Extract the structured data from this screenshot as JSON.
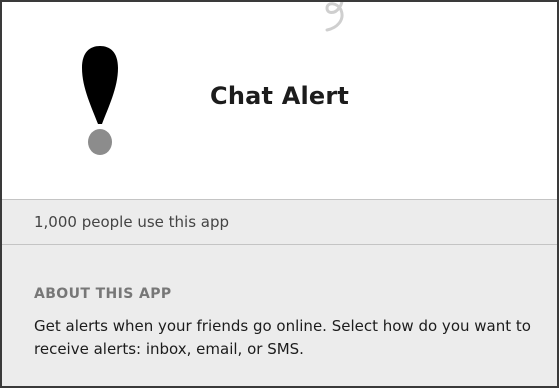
{
  "app": {
    "title": "Chat Alert",
    "icon": "exclamation-icon"
  },
  "usage": {
    "text": "1,000 people use this app"
  },
  "about": {
    "heading": "ABOUT THIS APP",
    "description": "Get alerts when your friends go online. Select how do you want to receive alerts: inbox, email, or SMS."
  },
  "colors": {
    "icon_dark": "#000000",
    "icon_dot": "#8c8c8c",
    "panel_bg": "#ececec",
    "border": "#3a3a3a"
  }
}
